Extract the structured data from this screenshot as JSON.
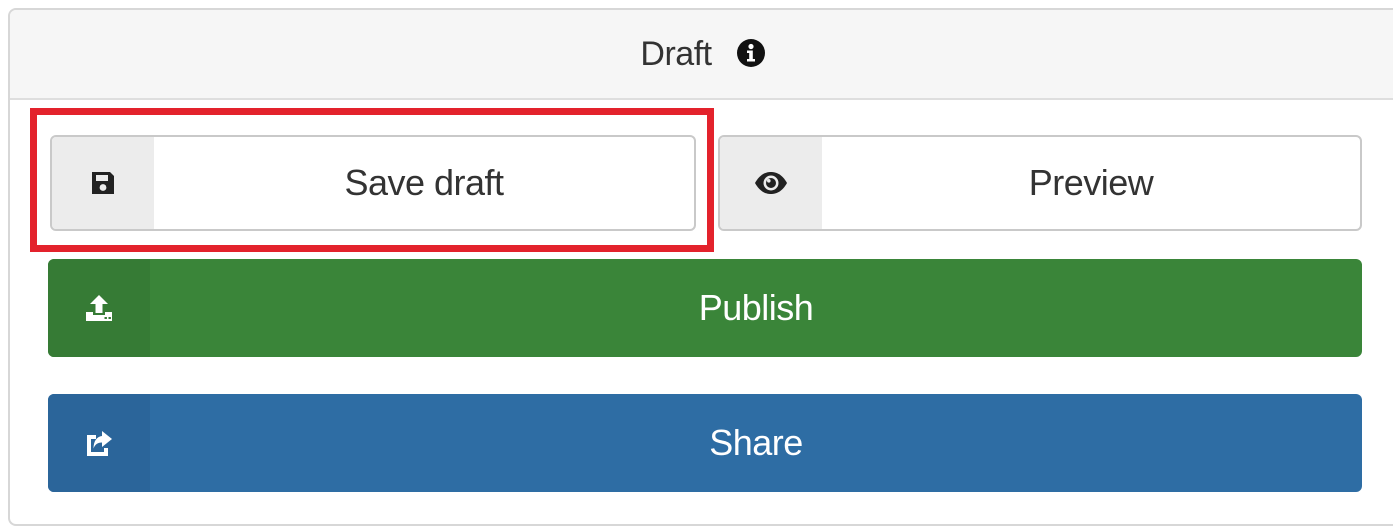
{
  "header": {
    "title": "Draft",
    "info_icon": "info-circle-icon"
  },
  "buttons": {
    "save": {
      "label": "Save draft",
      "icon": "floppy-disk-icon"
    },
    "preview": {
      "label": "Preview",
      "icon": "eye-icon"
    },
    "publish": {
      "label": "Publish",
      "icon": "upload-icon"
    },
    "share": {
      "label": "Share",
      "icon": "share-square-icon"
    }
  },
  "colors": {
    "publish": "#3a8539",
    "share": "#2e6da4",
    "highlight": "#e3222c"
  }
}
